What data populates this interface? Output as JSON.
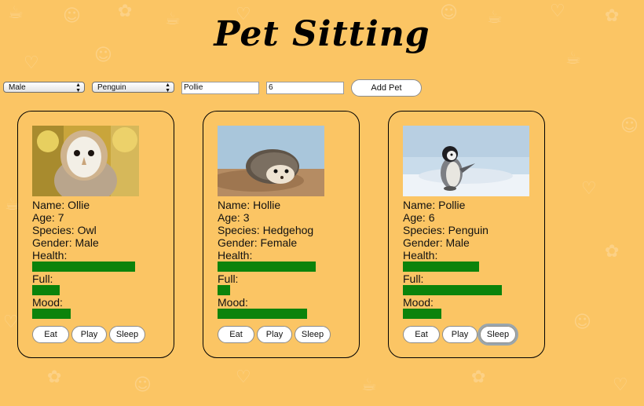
{
  "title": "Pet Sitting",
  "controls": {
    "gender_select": "Male",
    "species_select": "Penguin",
    "name_input": "Pollie",
    "age_input": "6",
    "add_button": "Add Pet"
  },
  "pets": [
    {
      "name_line": "Name: Ollie",
      "age_line": "Age: 7",
      "species_line": "Species: Owl",
      "gender_line": "Gender: Male",
      "health_label": "Health:",
      "full_label": "Full:",
      "mood_label": "Mood:",
      "health": 0.96,
      "full": 0.26,
      "mood": 0.36,
      "eat": "Eat",
      "play": "Play",
      "sleep": "Sleep"
    },
    {
      "name_line": "Name: Hollie",
      "age_line": "Age: 3",
      "species_line": "Species: Hedgehog",
      "gender_line": "Gender: Female",
      "health_label": "Health:",
      "full_label": "Full:",
      "mood_label": "Mood:",
      "health": 0.92,
      "full": 0.12,
      "mood": 0.84,
      "eat": "Eat",
      "play": "Play",
      "sleep": "Sleep"
    },
    {
      "name_line": "Name: Pollie",
      "age_line": "Age: 6",
      "species_line": "Species: Penguin",
      "gender_line": "Gender: Male",
      "health_label": "Health:",
      "full_label": "Full:",
      "mood_label": "Mood:",
      "health": 0.71,
      "full": 0.93,
      "mood": 0.36,
      "eat": "Eat",
      "play": "Play",
      "sleep": "Sleep"
    }
  ],
  "colors": {
    "background": "#fbc564",
    "bar": "#0b830b"
  },
  "icons": [
    "owl-photo",
    "hedgehog-photo",
    "penguin-photo"
  ]
}
